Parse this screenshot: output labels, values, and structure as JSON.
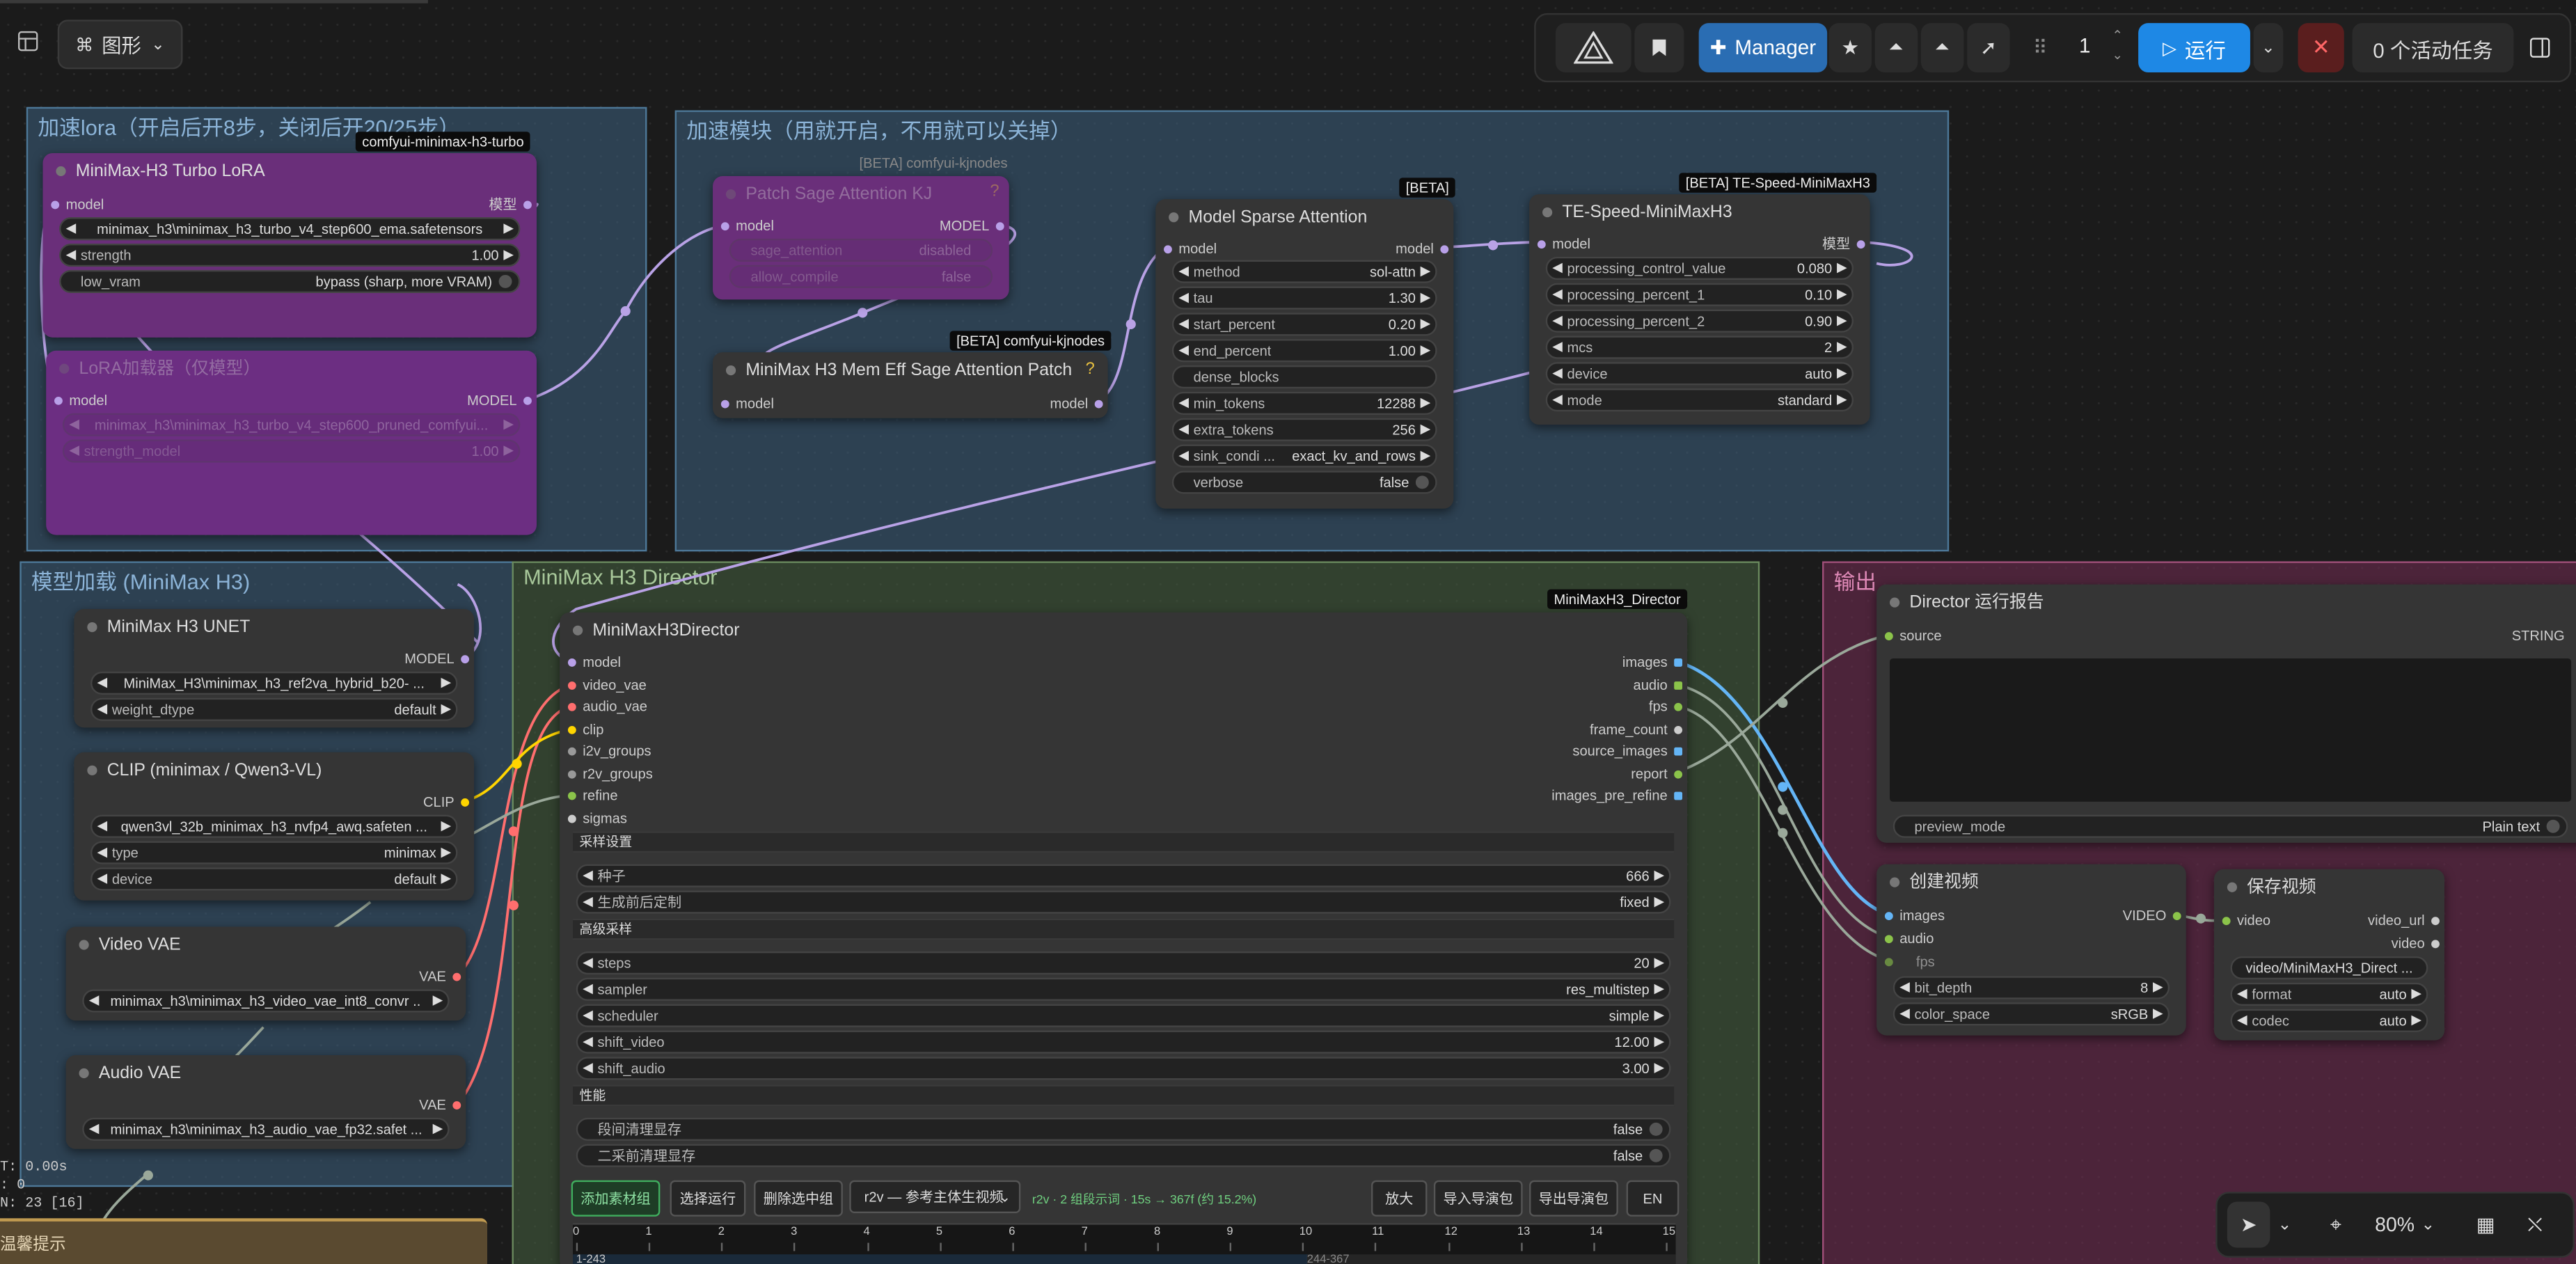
{
  "topbar": {
    "graph_label": "图形",
    "manager_label": "Manager",
    "queue_count": "1",
    "run_label": "运行",
    "active_tasks": "0 个活动任务"
  },
  "groups": {
    "lora": "加速lora（开启后开8步，关闭后开20/25步）",
    "accel": "加速模块（用就开启，不用就可以关掉）",
    "model_load": "模型加载 (MiniMax H3)",
    "director": "MiniMax H3 Director",
    "output": "输出"
  },
  "nodes": {
    "turbo_lora": {
      "title": "MiniMax-H3 Turbo LoRA",
      "badge": "comfyui-minimax-h3-turbo",
      "in_model": "model",
      "out_model": "模型",
      "file": "minimax_h3\\minimax_h3_turbo_v4_step600_ema.safetensors",
      "strength_label": "strength",
      "strength_value": "1.00",
      "low_vram_label": "low_vram",
      "low_vram_value": "bypass (sharp, more VRAM)"
    },
    "lora_loader": {
      "title": "LoRA加载器（仅模型）",
      "in_model": "model",
      "out_model": "MODEL",
      "file": "minimax_h3\\minimax_h3_turbo_v4_step600_pruned_comfyui...",
      "strength_label": "strength_model",
      "strength_value": "1.00"
    },
    "patch_sage": {
      "title": "Patch Sage Attention KJ",
      "badge": "[BETA] comfyui-kjnodes",
      "in_model": "model",
      "out_model": "MODEL",
      "w1_label": "sage_attention",
      "w1_value": "disabled",
      "w2_label": "allow_compile",
      "w2_value": "false"
    },
    "mem_eff": {
      "title": "MiniMax H3 Mem Eff Sage Attention Patch",
      "badge": "[BETA] comfyui-kjnodes",
      "in_model": "model",
      "out_model": "model"
    },
    "sparse": {
      "title": "Model Sparse Attention",
      "badge": "[BETA]",
      "in_model": "model",
      "out_model": "model",
      "widgets": [
        {
          "label": "method",
          "value": "sol-attn"
        },
        {
          "label": "tau",
          "value": "1.30"
        },
        {
          "label": "start_percent",
          "value": "0.20"
        },
        {
          "label": "end_percent",
          "value": "1.00"
        },
        {
          "label": "dense_blocks",
          "value": ""
        },
        {
          "label": "min_tokens",
          "value": "12288"
        },
        {
          "label": "extra_tokens",
          "value": "256"
        },
        {
          "label": "sink_condi ...",
          "value": "exact_kv_and_rows"
        },
        {
          "label": "verbose",
          "value": "false"
        }
      ]
    },
    "te_speed": {
      "title": "TE-Speed-MiniMaxH3",
      "badge": "[BETA] TE-Speed-MiniMaxH3",
      "in_model": "model",
      "out_model": "模型",
      "widgets": [
        {
          "label": "processing_control_value",
          "value": "0.080"
        },
        {
          "label": "processing_percent_1",
          "value": "0.10"
        },
        {
          "label": "processing_percent_2",
          "value": "0.90"
        },
        {
          "label": "mcs",
          "value": "2"
        },
        {
          "label": "device",
          "value": "auto"
        },
        {
          "label": "mode",
          "value": "standard"
        }
      ]
    },
    "unet": {
      "title": "MiniMax H3 UNET",
      "out": "MODEL",
      "file": "MiniMax_H3\\minimax_h3_ref2va_hybrid_b20- ...",
      "dtype_label": "weight_dtype",
      "dtype_value": "default"
    },
    "clip": {
      "title": "CLIP (minimax / Qwen3-VL)",
      "out": "CLIP",
      "file": "qwen3vl_32b_minimax_h3_nvfp4_awq.safeten ...",
      "type_label": "type",
      "type_value": "minimax",
      "device_label": "device",
      "device_value": "default"
    },
    "video_vae": {
      "title": "Video VAE",
      "out": "VAE",
      "file": "minimax_h3\\minimax_h3_video_vae_int8_convr ..."
    },
    "audio_vae": {
      "title": "Audio VAE",
      "out": "VAE",
      "file": "minimax_h3\\minimax_h3_audio_vae_fp32.safet ..."
    },
    "director": {
      "title": "MiniMaxH3Director",
      "badge": "MiniMaxH3_Director",
      "inputs": [
        "model",
        "video_vae",
        "audio_vae",
        "clip",
        "i2v_groups",
        "r2v_groups",
        "refine",
        "sigmas"
      ],
      "outputs": [
        "images",
        "audio",
        "fps",
        "frame_count",
        "source_images",
        "report",
        "images_pre_refine"
      ],
      "sec_sampling": "采样设置",
      "seed_label": "种子",
      "seed_value": "666",
      "control_label": "生成前后定制",
      "control_value": "fixed",
      "sec_advanced": "高级采样",
      "steps_label": "steps",
      "steps_value": "20",
      "sampler_label": "sampler",
      "sampler_value": "res_multistep",
      "scheduler_label": "scheduler",
      "scheduler_value": "simple",
      "shift_video_label": "shift_video",
      "shift_video_value": "12.00",
      "shift_audio_label": "shift_audio",
      "shift_audio_value": "3.00",
      "sec_perf": "性能",
      "perf1_label": "段间清理显存",
      "perf1_value": "false",
      "perf2_label": "二采前清理显存",
      "perf2_value": "false",
      "btn_add": "添加素材组",
      "btn_select": "选择运行",
      "btn_delete": "删除选中组",
      "mode_select": "r2v — 参考主体生视频",
      "mode_info": "r2v · 2 组段示词 · 15s → 367f (约 15.2%)",
      "btn_zoom": "放大",
      "btn_import": "导入导演包",
      "btn_export": "导出导演包",
      "btn_lang": "EN",
      "timeline_ticks": [
        "0",
        "1",
        "2",
        "3",
        "4",
        "5",
        "6",
        "7",
        "8",
        "9",
        "10",
        "11",
        "12",
        "13",
        "14",
        "15"
      ],
      "timeline_seg1": "1-243",
      "timeline_seg2": "244-367"
    },
    "report": {
      "title": "Director 运行报告",
      "in": "source",
      "out": "STRING",
      "preview_label": "preview_mode",
      "preview_value": "Plain text"
    },
    "create_video": {
      "title": "创建视频",
      "inputs": [
        "images",
        "audio",
        "fps"
      ],
      "out": "VIDEO",
      "bit_label": "bit_depth",
      "bit_value": "8",
      "cs_label": "color_space",
      "cs_value": "sRGB"
    },
    "save_video": {
      "title": "保存视频",
      "in": "video",
      "out1": "video_url",
      "out2": "video",
      "path": "video/MiniMaxH3_Direct ...",
      "format_label": "format",
      "format_value": "auto",
      "codec_label": "codec",
      "codec_value": "auto"
    }
  },
  "stats": {
    "line1": "T: 0.00s",
    "line2": ": 0",
    "line3": "N: 23 [16]",
    "tip": "温馨提示"
  },
  "bottom_toolbar": {
    "zoom": "80%"
  },
  "colors": {
    "run_blue": "#1e88e5",
    "manager_blue": "#2a6db3",
    "stop_red": "#c62828",
    "wire_model": "#b9a2e6",
    "wire_vae": "#ff6e6e",
    "wire_clip": "#ffd500",
    "wire_image": "#64b5f6",
    "wire_audio": "#8bc34a"
  }
}
